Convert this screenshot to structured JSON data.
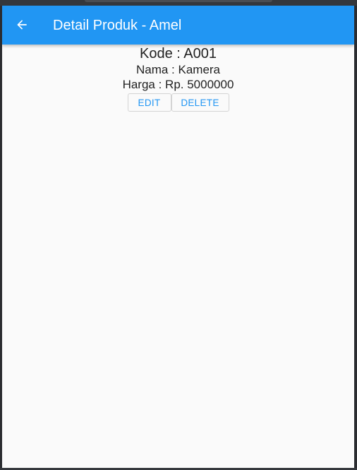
{
  "appbar": {
    "title": "Detail Produk - Amel",
    "back_icon": "arrow-back-icon",
    "color": "#2196f3"
  },
  "product": {
    "kode": "Kode : A001",
    "nama": "Nama : Kamera",
    "harga": "Harga : Rp. 5000000"
  },
  "actions": {
    "edit_label": "EDIT",
    "delete_label": "DELETE",
    "accent": "#2196f3"
  }
}
